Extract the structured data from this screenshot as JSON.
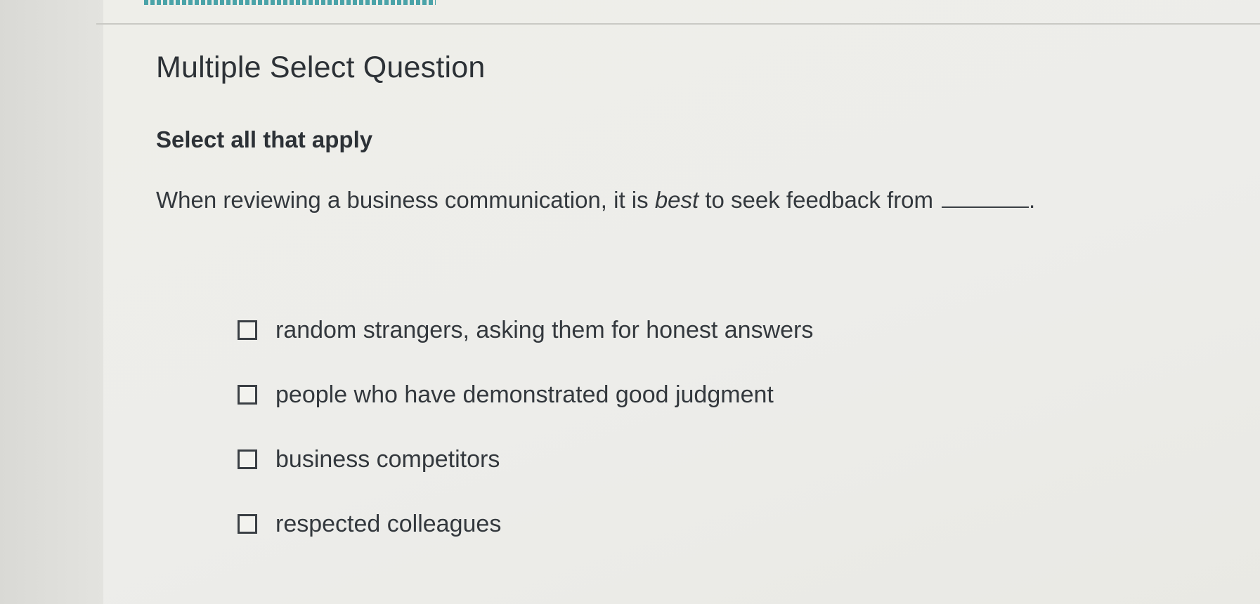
{
  "question": {
    "type_label": "Multiple Select Question",
    "instruction": "Select all that apply",
    "prompt_before": "When reviewing a business communication, it is ",
    "prompt_emphasis": "best",
    "prompt_after": " to seek feedback from",
    "prompt_end": "."
  },
  "options": [
    {
      "label": "random strangers, asking them for honest answers",
      "checked": false
    },
    {
      "label": "people who have demonstrated good judgment",
      "checked": false
    },
    {
      "label": "business competitors",
      "checked": false
    },
    {
      "label": "respected colleagues",
      "checked": false
    }
  ],
  "colors": {
    "progress_accent": "#4aa3a8",
    "text": "#2e3338"
  }
}
